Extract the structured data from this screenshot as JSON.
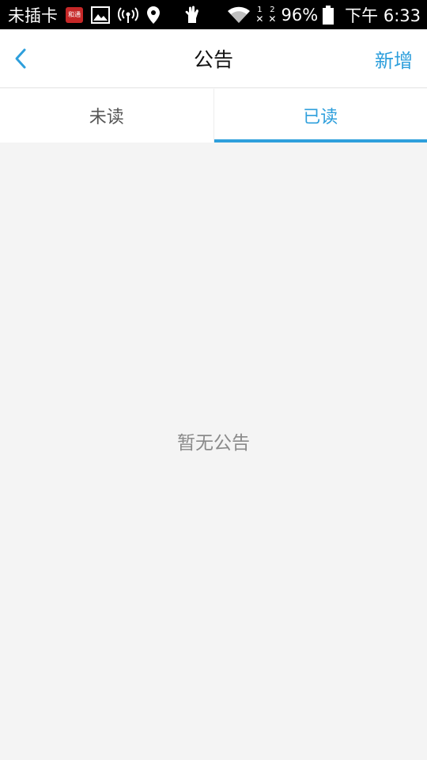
{
  "status_bar": {
    "carrier": "未插卡",
    "app_badge_text": "和通",
    "icons_left": [
      "app-badge-icon",
      "image-icon",
      "hotspot-icon",
      "location-icon",
      "glove-icon"
    ],
    "icons_right": [
      "wifi-icon",
      "sim1-icon",
      "sim2-icon",
      "battery-icon"
    ],
    "sim1_label": "1",
    "sim2_label": "2",
    "battery_percent": "96%",
    "time": "下午 6:33"
  },
  "header": {
    "title": "公告",
    "add_label": "新增",
    "back_icon": "chevron-left-icon",
    "accent_color": "#2e9fdc"
  },
  "tabs": [
    {
      "label": "未读",
      "active": false
    },
    {
      "label": "已读",
      "active": true
    }
  ],
  "content": {
    "empty_message": "暂无公告"
  }
}
